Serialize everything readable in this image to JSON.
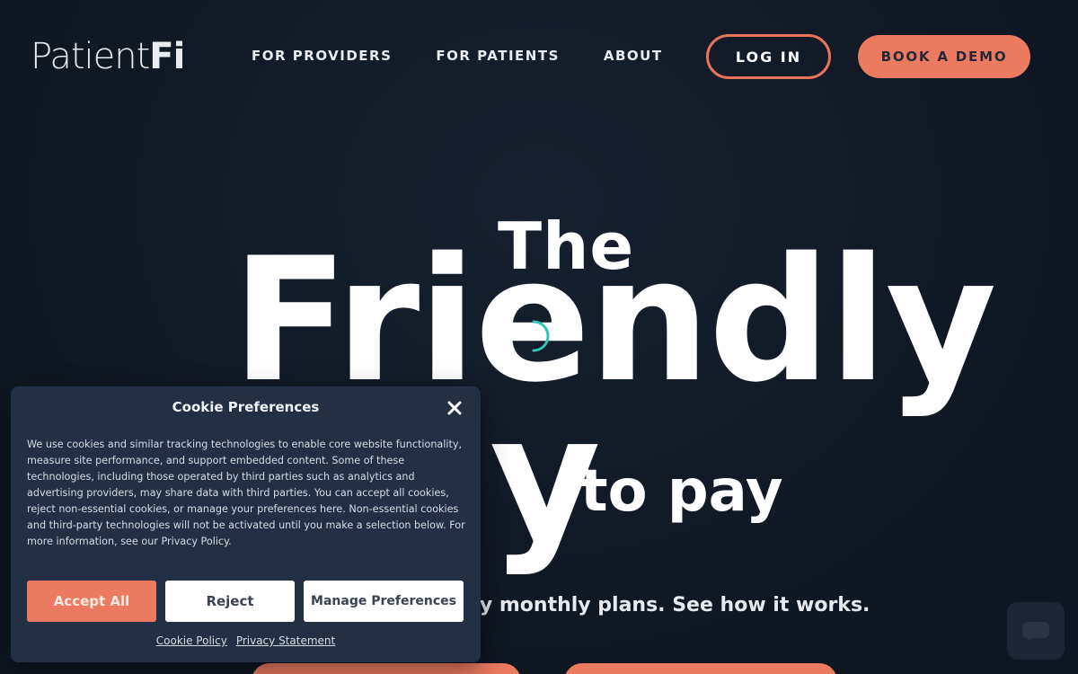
{
  "header": {
    "logo": {
      "text": "Patient",
      "accent": "Fi"
    },
    "nav": [
      "FOR PROVIDERS",
      "FOR PATIENTS",
      "ABOUT"
    ],
    "login_label": "LOG IN",
    "demo_label": "BOOK A DEMO"
  },
  "hero": {
    "line1": "The",
    "line2": "Friendly",
    "line3": "y",
    "line4": "to pay",
    "subtitle": "endly monthly plans. See how it works."
  },
  "cookie_modal": {
    "title": "Cookie Preferences",
    "body": "We use cookies and similar tracking technologies to enable core website functionality, measure site performance, and support embedded content. Some of these technologies, including those operated by third parties such as analytics and advertising providers, may share data with third parties. You can accept all cookies, reject non-essential cookies, or manage your preferences here. Non-essential cookies and third-party technologies will not be activated until you make a selection below. For more information, see our Privacy Policy.",
    "accept_label": "Accept All",
    "reject_label": "Reject",
    "manage_label": "Manage Preferences",
    "links": [
      "Cookie Policy",
      "Privacy Statement"
    ]
  },
  "colors": {
    "background": "#0f1722",
    "accent": "#ec7a60",
    "spinner": "#2ec4b6",
    "modal": "#233044"
  },
  "icons": {
    "close": "close-icon",
    "spinner": "loading-spinner-icon",
    "chat": "chat-icon"
  }
}
